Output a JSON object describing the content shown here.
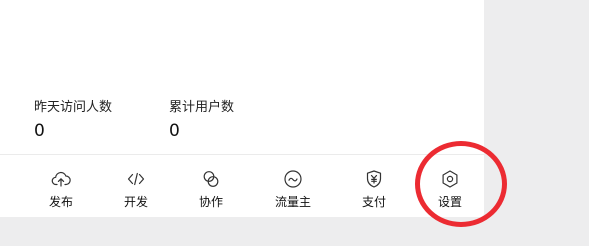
{
  "stats": [
    {
      "label": "昨天访问人数",
      "value": "0"
    },
    {
      "label": "累计用户数",
      "value": "0"
    }
  ],
  "nav": [
    {
      "label": "发布",
      "icon": "cloud-upload-icon"
    },
    {
      "label": "开发",
      "icon": "code-icon"
    },
    {
      "label": "协作",
      "icon": "collaborate-icon"
    },
    {
      "label": "流量主",
      "icon": "traffic-icon"
    },
    {
      "label": "支付",
      "icon": "yuan-shield-icon"
    },
    {
      "label": "设置",
      "icon": "gear-icon"
    }
  ],
  "colors": {
    "page_background": "#ededee",
    "card_background": "#ffffff",
    "highlight_ring": "#ec2b32"
  }
}
